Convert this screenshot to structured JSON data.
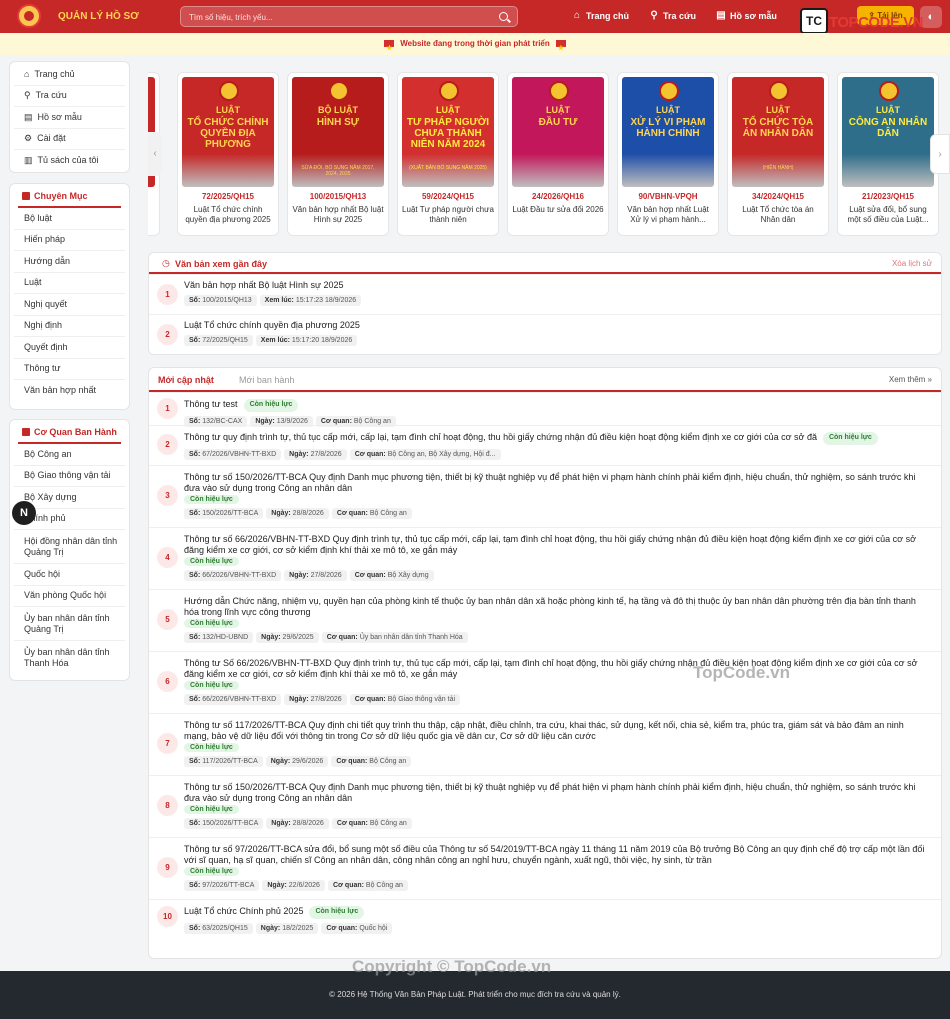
{
  "header": {
    "brand": "QUẢN LÝ HỒ SƠ",
    "search_placeholder": "Tìm số hiệu, trích yếu...",
    "nav": [
      {
        "label": "Trang chủ",
        "icon": "home-icon"
      },
      {
        "label": "Tra cứu",
        "icon": "search-icon"
      },
      {
        "label": "Hồ sơ mẫu",
        "icon": "document-icon"
      }
    ],
    "upload_label": "Tải lên"
  },
  "notice": "Website đang trong thời gian phát triển",
  "sidebar": {
    "main": [
      {
        "label": "Trang chủ",
        "icon": "home-icon"
      },
      {
        "label": "Tra cứu",
        "icon": "search-icon"
      },
      {
        "label": "Hồ sơ mẫu",
        "icon": "document-icon"
      },
      {
        "label": "Cài đặt",
        "icon": "gear-icon"
      },
      {
        "label": "Tủ sách của tôi",
        "icon": "bookshelf-icon"
      }
    ],
    "categories_title": "Chuyên Mục",
    "categories": [
      "Bộ luật",
      "Hiến pháp",
      "Hướng dẫn",
      "Luật",
      "Nghị quyết",
      "Nghị định",
      "Quyết định",
      "Thông tư",
      "Văn bản hợp nhất"
    ],
    "agencies_title": "Cơ Quan Ban Hành",
    "agencies": [
      "Bộ Công an",
      "Bộ Giao thông vận tải",
      "Bộ Xây dựng",
      "Chính phủ",
      "Hội đồng nhân dân tỉnh Quảng Trị",
      "Quốc hội",
      "Văn phòng Quốc hội",
      "Ủy ban nhân dân tỉnh Quảng Trị",
      "Ủy ban nhân dân tỉnh Thanh Hóa"
    ]
  },
  "slides": [
    {
      "type": "LUẬT",
      "title": "TỔ CHỨC CHÍNH QUYỀN ĐỊA PHƯƠNG",
      "note": "",
      "code": "72/2025/QH15",
      "caption": "Luật Tổ chức chính quyền địa phương 2025",
      "bg": "#c62828",
      "fg": "#ffd54f"
    },
    {
      "type": "BỘ LUẬT",
      "title": "HÌNH SỰ",
      "note": "SỬA ĐỔI, BỔ SUNG NĂM 2017, 2024, 2025",
      "code": "100/2015/QH13",
      "caption": "Văn bản hợp nhất Bộ luật Hình sự 2025",
      "bg": "#b71c1c",
      "fg": "#ffd54f"
    },
    {
      "type": "LUẬT",
      "title": "TƯ PHÁP NGƯỜI CHƯA THÀNH NIÊN NĂM 2024",
      "note": "(XUẤT BẢN BỔ SUNG NĂM 2025)",
      "code": "59/2024/QH15",
      "caption": "Luật Tư pháp người chưa thành niên",
      "bg": "#d32f2f",
      "fg": "#ffeb3b"
    },
    {
      "type": "LUẬT",
      "title": "ĐẦU TƯ",
      "note": "",
      "code": "24/2026/QH16",
      "caption": "Luật Đầu tư sửa đổi 2026",
      "bg": "#c2185b",
      "fg": "#ffd54f"
    },
    {
      "type": "LUẬT",
      "title": "XỬ LÝ VI PHẠM HÀNH CHÍNH",
      "note": "",
      "code": "90/VBHN-VPQH",
      "caption": "Văn bản hợp nhất Luật Xử lý vi phạm hành...",
      "bg": "#1e4fa8",
      "fg": "#ffd54f"
    },
    {
      "type": "LUẬT",
      "title": "TỔ CHỨC TÒA ÁN NHÂN DÂN",
      "note": "(HIỆN HÀNH)",
      "code": "34/2024/QH15",
      "caption": "Luật Tổ chức tòa án Nhân dân",
      "bg": "#c62828",
      "fg": "#ffd54f"
    },
    {
      "type": "LUẬT",
      "title": "CÔNG AN NHÂN DÂN",
      "note": "",
      "code": "21/2023/QH15",
      "caption": "Luật sửa đổi, bổ sung một số điều của Luật...",
      "bg": "#2e6e8a",
      "fg": "#ffeb3b"
    }
  ],
  "recent": {
    "title": "Văn bản xem gần đây",
    "clear": "Xóa lịch sử",
    "so_label": "Số:",
    "time_label": "Xem lúc:",
    "items": [
      {
        "no": "1",
        "title": "Văn bản hợp nhất Bộ luật Hình sự 2025",
        "so": "100/2015/QH13",
        "time": "15:17:23 18/9/2026"
      },
      {
        "no": "2",
        "title": "Luật Tổ chức chính quyền địa phương 2025",
        "so": "72/2025/QH15",
        "time": "15:17:20 18/9/2026"
      }
    ]
  },
  "updates": {
    "tab_active": "Mới cập nhật",
    "tab_other": "Mới ban hành",
    "more": "Xem thêm »",
    "so_label": "Số:",
    "date_label": "Ngày:",
    "agency_label": "Cơ quan:",
    "items": [
      {
        "no": "1",
        "title": "Thông tư test",
        "badge": "Còn hiệu lực",
        "so": "132/BC-CAX",
        "date": "13/9/2026",
        "agency": "Bộ Công an"
      },
      {
        "no": "2",
        "title": "Thông tư quy định trình tự, thủ tục cấp mới, cấp lại, tạm đình chỉ hoạt động, thu hồi giấy chứng nhận đủ điều kiện hoạt động kiểm định xe cơ giới của cơ sở đă",
        "badge": "Còn hiệu lực",
        "so": "67/2026/VBHN-TT-BXD",
        "date": "27/8/2026",
        "agency": "Bộ Công an, Bộ Xây dựng, Hội đ..."
      },
      {
        "no": "3",
        "title": "Thông tư số 150/2026/TT-BCA Quy định Danh mục phương tiện, thiết bị kỹ thuật nghiệp vụ để phát hiện vi phạm hành chính phải kiểm định, hiệu chuẩn, thử nghiệm, so sánh trước khi đưa vào sử dụng trong Công an nhân dân",
        "badge": "Còn hiệu lực",
        "so": "150/2026/TT-BCA",
        "date": "28/8/2026",
        "agency": "Bộ Công an"
      },
      {
        "no": "4",
        "title": "Thông tư số 66/2026/VBHN-TT-BXD Quy định trình tự, thủ tục cấp mới, cấp lại, tạm đình chỉ hoạt động, thu hồi giấy chứng nhận đủ điều kiện hoạt động kiểm định xe cơ giới của cơ sở đăng kiểm xe cơ giới, cơ sở kiểm định khí thải xe mô tô, xe gắn máy",
        "badge": "Còn hiệu lực",
        "so": "66/2026/VBHN-TT-BXD",
        "date": "27/8/2026",
        "agency": "Bộ Xây dựng"
      },
      {
        "no": "5",
        "title": "Hướng dẫn Chức năng, nhiệm vụ, quyền hạn của phòng kinh tế thuộc ủy ban nhân dân xã hoặc phòng kinh tế, hạ tầng và đô thị thuộc ủy ban nhân dân phường trên địa bàn tỉnh thanh hóa trong lĩnh vực công thương",
        "badge": "Còn hiệu lực",
        "so": "132/HD-UBND",
        "date": "29/6/2025",
        "agency": "Ủy ban nhân dân tỉnh Thanh Hóa"
      },
      {
        "no": "6",
        "title": "Thông tư Số 66/2026/VBHN-TT-BXD Quy định trình tự, thủ tục cấp mới, cấp lại, tạm đình chỉ hoạt động, thu hồi giấy chứng nhận đủ điều kiện hoạt động kiểm định xe cơ giới của cơ sở đăng kiểm xe cơ giới, cơ sở kiểm định khí thải xe mô tô, xe gắn máy",
        "badge": "Còn hiệu lực",
        "so": "66/2026/VBHN-TT-BXD",
        "date": "27/8/2026",
        "agency": "Bộ Giao thông vận tải"
      },
      {
        "no": "7",
        "title": "Thông tư số 117/2026/TT-BCA Quy định chi tiết quy trình thu thập, cập nhật, điều chỉnh, tra cứu, khai thác, sử dụng, kết nối, chia sẻ, kiểm tra, phúc tra, giám sát và bảo đảm an ninh mạng, bảo vệ dữ liệu đối với thông tin trong Cơ sở dữ liệu quốc gia về dân cư, Cơ sở dữ liệu căn cước",
        "badge": "Còn hiệu lực",
        "so": "117/2026/TT-BCA",
        "date": "29/6/2026",
        "agency": "Bộ Công an"
      },
      {
        "no": "8",
        "title": "Thông tư số 150/2026/TT-BCA Quy định Danh mục phương tiện, thiết bị kỹ thuật nghiệp vụ để phát hiện vi phạm hành chính phải kiểm định, hiệu chuẩn, thử nghiệm, so sánh trước khi đưa vào sử dụng trong Công an nhân dân",
        "badge": "Còn hiệu lực",
        "so": "150/2026/TT-BCA",
        "date": "28/8/2026",
        "agency": "Bộ Công an"
      },
      {
        "no": "9",
        "title": "Thông tư số 97/2026/TT-BCA sửa đổi, bổ sung một số điều của Thông tư số 54/2019/TT-BCA ngày 11 tháng 11 năm 2019 của Bộ trưởng Bộ Công an quy định chế độ trợ cấp một lần đối với sĩ quan, hạ sĩ quan, chiến sĩ Công an nhân dân, công nhân công an nghỉ hưu, chuyển ngành, xuất ngũ, thôi việc, hy sinh, từ trần",
        "badge": "Còn hiệu lực",
        "so": "97/2026/TT-BCA",
        "date": "22/6/2026",
        "agency": "Bộ Công an"
      },
      {
        "no": "10",
        "title": "Luật Tổ chức Chính phủ 2025",
        "badge": "Còn hiệu lực",
        "so": "63/2025/QH15",
        "date": "18/2/2025",
        "agency": "Quốc hội"
      }
    ]
  },
  "footer": "© 2026 Hệ Thống Văn Bản Pháp Luật. Phát triển cho mục đích tra cứu và quản lý.",
  "watermark": {
    "logo_text": "TOPCODE.VN",
    "center": "TopCode.vn",
    "bottom": "Copyright © TopCode.vn"
  },
  "fab_label": "N"
}
